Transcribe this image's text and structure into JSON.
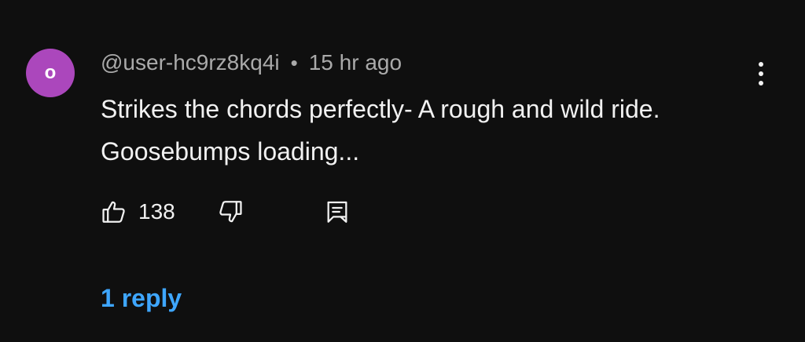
{
  "comment": {
    "avatar_letter": "o",
    "avatar_color": "#ab47bc",
    "author": "@user-hc9rz8kq4i",
    "separator": "•",
    "timestamp": "15 hr ago",
    "text": "Strikes the chords perfectly- A rough and wild ride. Goosebumps loading...",
    "like_count": "138",
    "replies_label": "1 reply",
    "replies_color": "#3ea6ff"
  },
  "icons": {
    "like": "thumbs-up-icon",
    "dislike": "thumbs-down-icon",
    "reply": "comment-reply-icon",
    "menu": "more-vertical-icon"
  }
}
